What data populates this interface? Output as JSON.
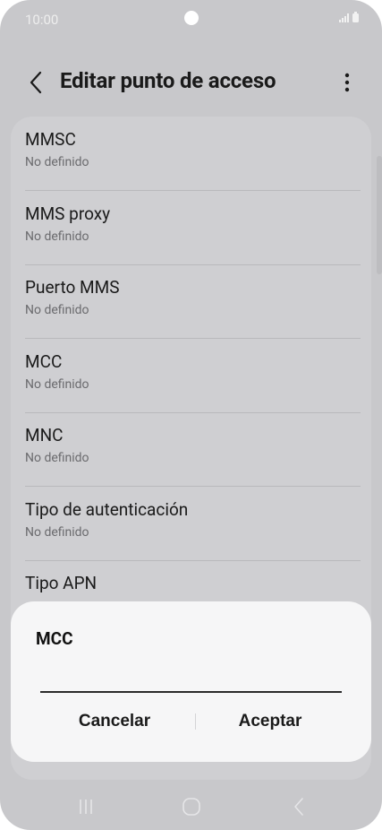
{
  "status_bar": {
    "time": "10:00"
  },
  "header": {
    "title": "Editar punto de acceso"
  },
  "list": {
    "items": [
      {
        "title": "MMSC",
        "subtitle": "No definido"
      },
      {
        "title": "MMS proxy",
        "subtitle": "No definido"
      },
      {
        "title": "Puerto MMS",
        "subtitle": "No definido"
      },
      {
        "title": "MCC",
        "subtitle": "No definido"
      },
      {
        "title": "MNC",
        "subtitle": "No definido"
      },
      {
        "title": "Tipo de autenticación",
        "subtitle": "No definido"
      },
      {
        "title": "Tipo APN",
        "subtitle": ""
      }
    ]
  },
  "dialog": {
    "title": "MCC",
    "input_value": "",
    "cancel_label": "Cancelar",
    "accept_label": "Aceptar"
  },
  "icons": {
    "back": "chevron-left-icon",
    "more": "more-vertical-icon",
    "nav_recents": "recents-icon",
    "nav_home": "home-icon",
    "nav_back": "nav-back-icon"
  },
  "colors": {
    "background": "#c8c8cb",
    "card": "#cfcfd2",
    "dialog": "#f6f6f7",
    "text": "#1a1a1a",
    "secondary_text": "#6b6b6e"
  }
}
